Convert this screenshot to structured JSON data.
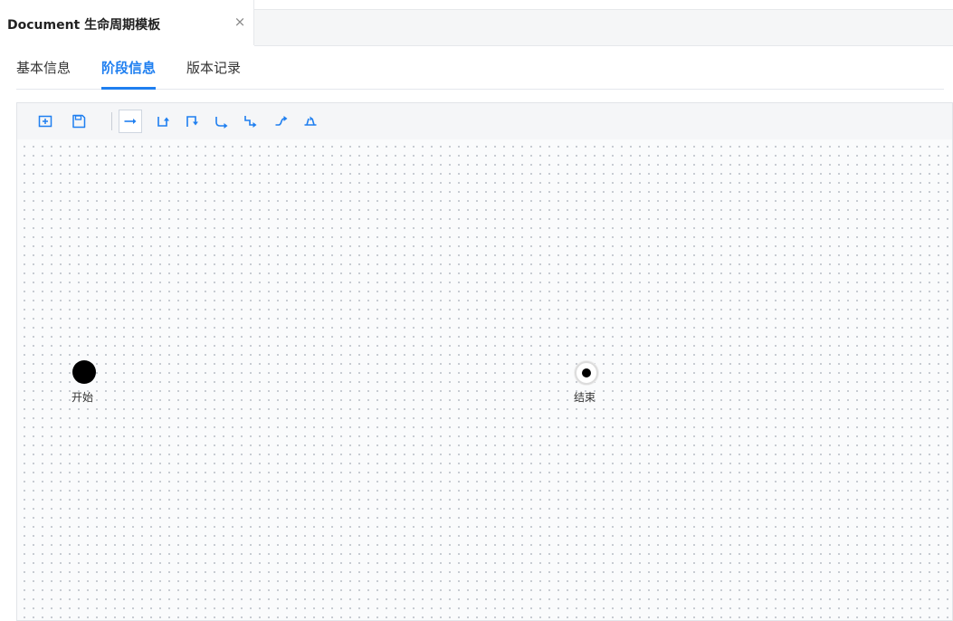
{
  "window_tab": {
    "title": "Document 生命周期模板",
    "close_glyph": "×"
  },
  "subtabs": [
    {
      "label": "基本信息",
      "active": false
    },
    {
      "label": "阶段信息",
      "active": true
    },
    {
      "label": "版本记录",
      "active": false
    }
  ],
  "toolbar": {
    "tools": [
      {
        "icon": "add-node-icon",
        "active": false
      },
      {
        "icon": "save-icon",
        "active": false
      },
      {
        "icon": "straight-connector-icon",
        "active": true
      },
      {
        "icon": "elbow-up-connector-icon",
        "active": false
      },
      {
        "icon": "elbow-down-connector-icon",
        "active": false
      },
      {
        "icon": "curved-elbow-connector-icon",
        "active": false
      },
      {
        "icon": "step-connector-icon",
        "active": false
      },
      {
        "icon": "curved-connector-icon",
        "active": false
      },
      {
        "icon": "loop-connector-icon",
        "active": false
      }
    ]
  },
  "diagram": {
    "start_label": "开始",
    "end_label": "结束"
  },
  "colors": {
    "accent": "#1f7ff0",
    "icon": "#1f7ff0",
    "canvas_dot": "#b9bec7"
  }
}
